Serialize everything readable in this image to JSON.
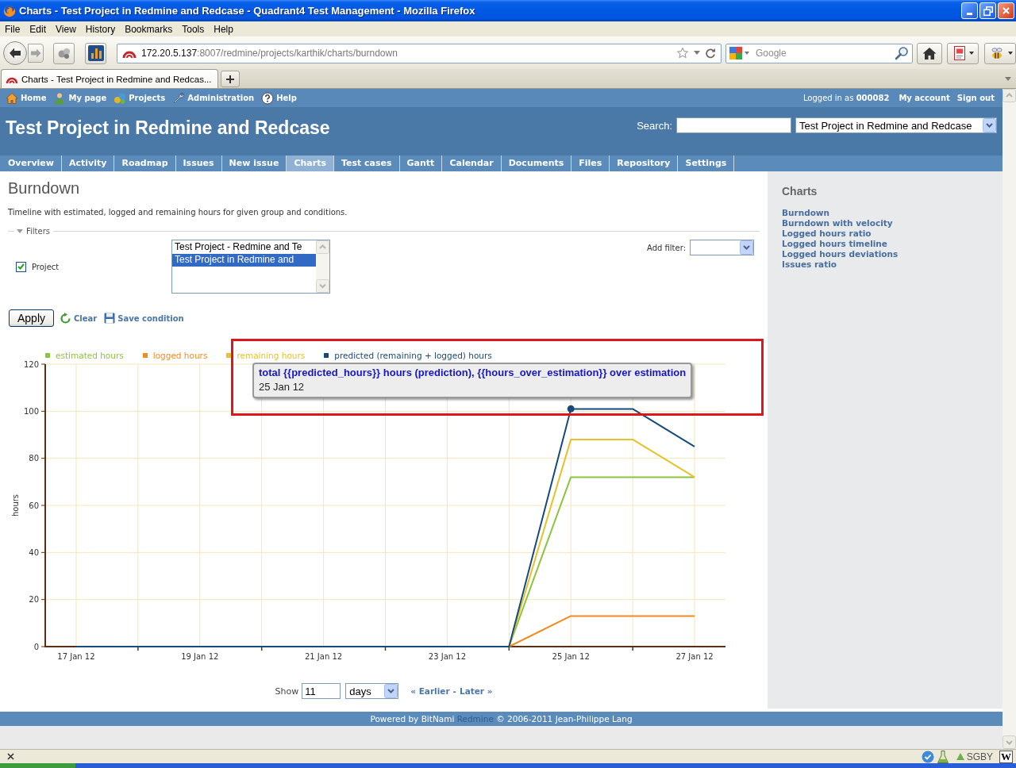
{
  "window": {
    "title": "Charts - Test Project in Redmine and Redcase - Quadrant4 Test Management - Mozilla Firefox"
  },
  "menu_bar": [
    "File",
    "Edit",
    "View",
    "History",
    "Bookmarks",
    "Tools",
    "Help"
  ],
  "address_bar": {
    "host": "172.20.5.137",
    "path": ":8007/redmine/projects/karthik/charts/burndown"
  },
  "search_bar": {
    "placeholder": "Google"
  },
  "tabs": [
    {
      "label": "Charts - Test Project in Redmine and Redcas...",
      "selected": true
    }
  ],
  "top_menu": {
    "items": [
      {
        "kind": "home",
        "label": "Home"
      },
      {
        "kind": "user",
        "label": "My page"
      },
      {
        "kind": "projects",
        "label": "Projects"
      },
      {
        "kind": "admin",
        "label": "Administration"
      },
      {
        "kind": "help",
        "label": "Help"
      }
    ],
    "logged_in": "Logged in as **000082**",
    "links": [
      "My account",
      "Sign out"
    ]
  },
  "header": {
    "title": "Test Project in Redmine and Redcase",
    "search_label": "Search:",
    "project_select": "Test Project in Redmine and Redcase"
  },
  "main_menu": [
    {
      "label": "Overview",
      "selected": false
    },
    {
      "label": "Activity",
      "selected": false
    },
    {
      "label": "Roadmap",
      "selected": false
    },
    {
      "label": "Issues",
      "selected": false
    },
    {
      "label": "New issue",
      "selected": false
    },
    {
      "label": "Charts",
      "selected": true
    },
    {
      "label": "Test cases",
      "selected": false
    },
    {
      "label": "Gantt",
      "selected": false
    },
    {
      "label": "Calendar",
      "selected": false
    },
    {
      "label": "Documents",
      "selected": false
    },
    {
      "label": "Files",
      "selected": false
    },
    {
      "label": "Repository",
      "selected": false
    },
    {
      "label": "Settings",
      "selected": false
    }
  ],
  "content": {
    "heading": "Burndown",
    "description": "Timeline with estimated, logged and remaining hours for given group and conditions.",
    "filters": {
      "legend": "Filters",
      "expanded": true,
      "project": {
        "label": "Project",
        "checked": true,
        "options": [
          {
            "label": "Test Project - Redmine and Te",
            "selected": false
          },
          {
            "label": "Test Project in Redmine and",
            "selected": true
          }
        ]
      },
      "add_filter_label": "Add filter:"
    },
    "actions": {
      "apply": "Apply",
      "clear": "Clear",
      "save": "Save condition"
    },
    "chart": {
      "chart_data": {
        "type": "line",
        "ylabel": "hours",
        "categories": [
          "17 Jan 12",
          null,
          "19 Jan 12",
          null,
          "21 Jan 12",
          null,
          "23 Jan 12",
          null,
          "25 Jan 12",
          null,
          "27 Jan 12"
        ],
        "ylim": [
          0,
          120
        ],
        "yticks": [
          0,
          20,
          40,
          60,
          80,
          100,
          120
        ],
        "grid": true,
        "legend": "top",
        "series": [
          {
            "name": "estimated hours",
            "color": "#8cc43f",
            "values": [
              null,
              null,
              null,
              null,
              null,
              null,
              null,
              0,
              72,
              72,
              72
            ]
          },
          {
            "name": "logged hours",
            "color": "#f38a1f",
            "values": [
              null,
              null,
              null,
              null,
              null,
              null,
              null,
              0,
              13,
              13,
              13
            ]
          },
          {
            "name": "remaining hours",
            "color": "#e5c22c",
            "values": [
              null,
              null,
              null,
              null,
              null,
              null,
              null,
              0,
              88,
              88,
              72
            ]
          },
          {
            "name": "predicted (remaining + logged) hours",
            "color": "#174a7c",
            "values": [
              0,
              0,
              0,
              0,
              0,
              0,
              0,
              0,
              101,
              101,
              85
            ]
          }
        ],
        "annotations": [
          {
            "x": "25 Jan 12",
            "y": 101,
            "text": "total {{predicted_hours}} hours (prediction), {{hours_over_estimation}} over estimation"
          }
        ]
      },
      "tooltip_date": "25 Jan 12",
      "highlighted": true
    },
    "range": {
      "label": "Show",
      "value": "11",
      "unit": "days",
      "earlier": "« Earlier",
      "separator": "-",
      "later": "Later »"
    }
  },
  "sidebar": {
    "title": "Charts",
    "links": [
      "Burndown",
      "Burndown with velocity",
      "Logged hours ratio",
      "Logged hours timeline",
      "Logged hours deviations",
      "Issues ratio"
    ]
  },
  "footer": {
    "text": "Powered by BitNami",
    "link": "Redmine",
    "text_after": "© 2006-2011 Jean-Philippe Lang"
  },
  "status_bar": {
    "addon_label": "SGBY",
    "button_letter": "W"
  }
}
